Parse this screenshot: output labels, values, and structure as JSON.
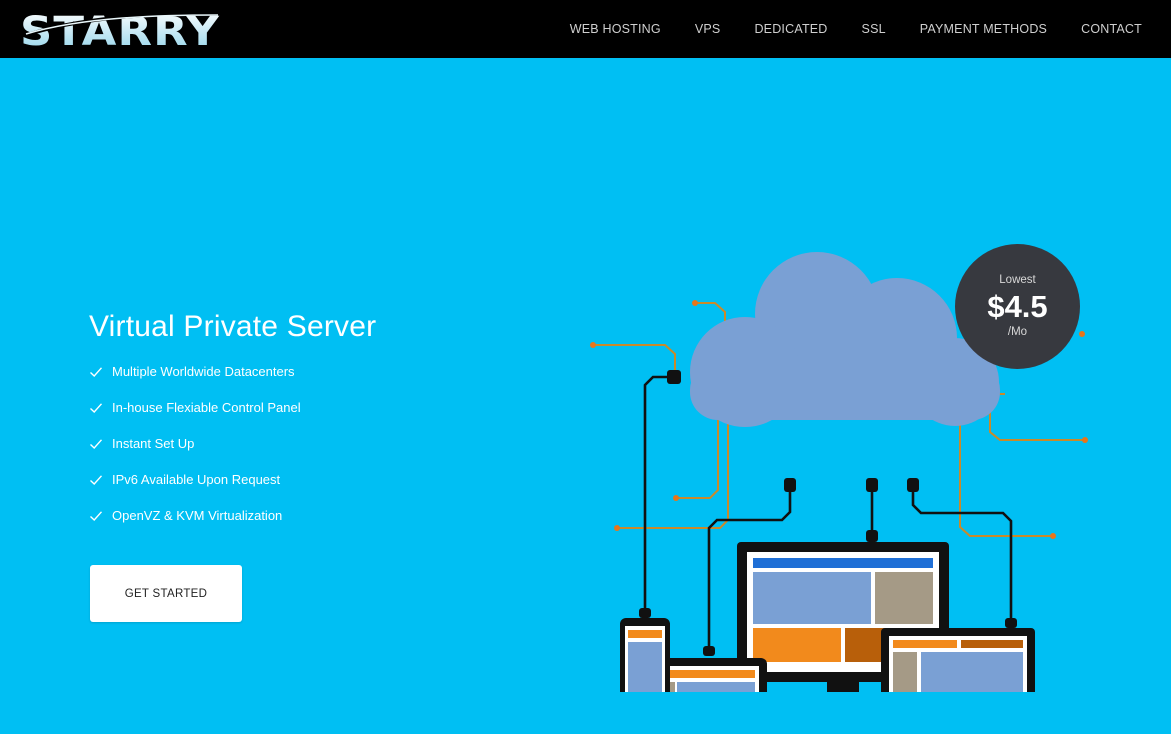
{
  "header": {
    "brand": "STARRY",
    "nav": [
      {
        "label": "WEB HOSTING"
      },
      {
        "label": "VPS"
      },
      {
        "label": "DEDICATED"
      },
      {
        "label": "SSL"
      },
      {
        "label": "PAYMENT METHODS"
      },
      {
        "label": "CONTACT"
      }
    ]
  },
  "hero": {
    "title": "Virtual Private Server",
    "features": [
      "Multiple Worldwide Datacenters",
      "In-house Flexiable Control Panel",
      "Instant Set Up",
      "IPv6 Available Upon Request",
      "OpenVZ & KVM Virtualization"
    ],
    "cta_label": "GET STARTED",
    "background": "#00bff3"
  },
  "price_badge": {
    "label": "Lowest",
    "amount": "$4.5",
    "period": "/Mo"
  },
  "icons": {
    "check": "check-icon",
    "cloud": "cloud-icon",
    "devices": [
      "phone-icon",
      "tablet-icon",
      "desktop-icon",
      "laptop-icon"
    ]
  }
}
